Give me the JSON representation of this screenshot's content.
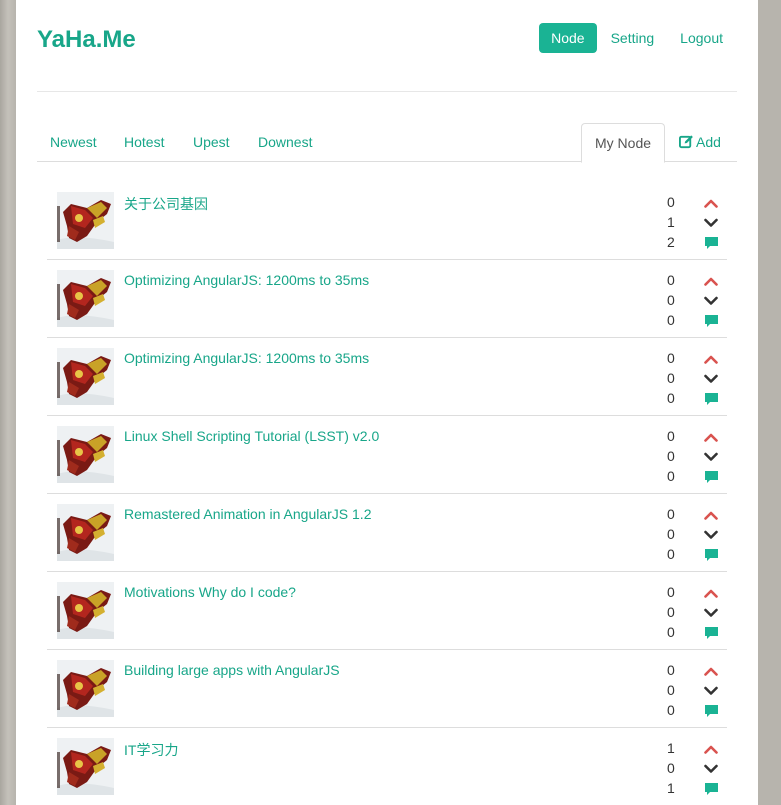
{
  "header": {
    "brand": "YaHa.Me",
    "nav": [
      {
        "label": "Node",
        "active": true
      },
      {
        "label": "Setting",
        "active": false
      },
      {
        "label": "Logout",
        "active": false
      }
    ]
  },
  "tabs": {
    "left": [
      "Newest",
      "Hotest",
      "Upest",
      "Downest"
    ],
    "my_node": "My Node",
    "add": "Add"
  },
  "colors": {
    "accent": "#1ab394",
    "link": "#18a689",
    "up": "#d9534f",
    "down": "#333333"
  },
  "icons": {
    "up": "chevron-up-icon",
    "down": "chevron-down-icon",
    "comment": "comment-icon",
    "add": "edit-icon"
  },
  "items": [
    {
      "title": "关于公司基因",
      "up": "0",
      "down": "1",
      "comments": "2"
    },
    {
      "title": "Optimizing AngularJS: 1200ms to 35ms",
      "up": "0",
      "down": "0",
      "comments": "0"
    },
    {
      "title": "Optimizing AngularJS: 1200ms to 35ms",
      "up": "0",
      "down": "0",
      "comments": "0"
    },
    {
      "title": "Linux Shell Scripting Tutorial (LSST) v2.0",
      "up": "0",
      "down": "0",
      "comments": "0"
    },
    {
      "title": "Remastered Animation in AngularJS 1.2",
      "up": "0",
      "down": "0",
      "comments": "0"
    },
    {
      "title": "Motivations Why do I code?",
      "up": "0",
      "down": "0",
      "comments": "0"
    },
    {
      "title": "Building large apps with AngularJS",
      "up": "0",
      "down": "0",
      "comments": "0"
    },
    {
      "title": "IT学习力",
      "up": "1",
      "down": "0",
      "comments": "1"
    }
  ]
}
